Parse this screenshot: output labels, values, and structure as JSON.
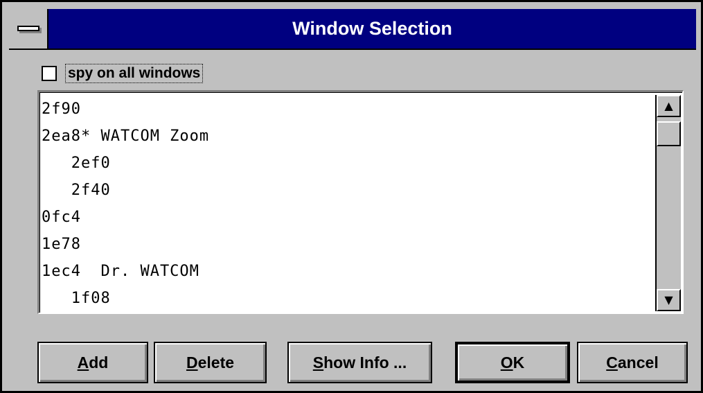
{
  "window": {
    "title": "Window Selection"
  },
  "spy_all": {
    "label": "spy on all windows",
    "checked": false
  },
  "window_list": {
    "items": [
      "2f90",
      "2ea8* WATCOM Zoom",
      "   2ef0",
      "   2f40",
      "0fc4",
      "1e78",
      "1ec4  Dr. WATCOM",
      "   1f08"
    ]
  },
  "buttons": {
    "add": {
      "mnemonic": "A",
      "rest": "dd"
    },
    "delete": {
      "mnemonic": "D",
      "rest": "elete"
    },
    "show_info": {
      "mnemonic": "S",
      "rest": "how Info ..."
    },
    "ok": {
      "mnemonic": "O",
      "rest": "K"
    },
    "cancel": {
      "mnemonic": "C",
      "rest": "ancel"
    }
  },
  "icons": {
    "system_menu": "system-menu-icon",
    "scroll_up": "arrow-up-icon",
    "scroll_down": "arrow-down-icon"
  },
  "colors": {
    "titlebar": "#000080",
    "face": "#c0c0c0"
  }
}
